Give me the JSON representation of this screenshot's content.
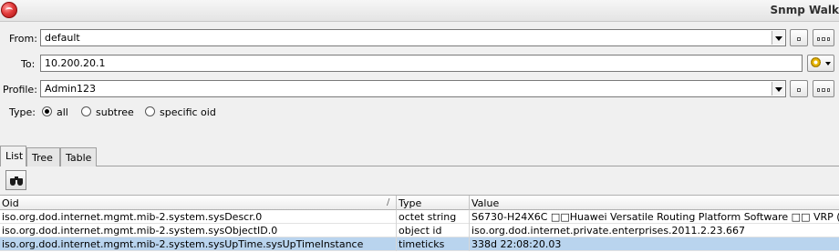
{
  "window": {
    "title": "Snmp Walk"
  },
  "form": {
    "from": {
      "label": "From:",
      "value": "default"
    },
    "to": {
      "label": "To:",
      "value": "10.200.20.1"
    },
    "profile": {
      "label": "Profile:",
      "value": "Admin123"
    },
    "type": {
      "label": "Type:",
      "options": [
        "all",
        "subtree",
        "specific oid"
      ],
      "selected": "all"
    }
  },
  "tabs": [
    "List",
    "Tree",
    "Table"
  ],
  "active_tab": "List",
  "toolbar": {
    "find_icon": "binoculars-icon"
  },
  "table": {
    "columns": [
      "Oid",
      "Type",
      "Value"
    ],
    "sort_indicator": "/",
    "rows": [
      {
        "oid": "iso.org.dod.internet.mgmt.mib-2.system.sysDescr.0",
        "type": "octet string",
        "value": "S6730-H24X6C □□Huawei Versatile Routing Platform Software □□ VRP (..."
      },
      {
        "oid": "iso.org.dod.internet.mgmt.mib-2.system.sysObjectID.0",
        "type": "object id",
        "value": "iso.org.dod.internet.private.enterprises.2011.2.23.667"
      },
      {
        "oid": "iso.org.dod.internet.mgmt.mib-2.system.sysUpTime.sysUpTimeInstance",
        "type": "timeticks",
        "value": "338d 22:08:20.03"
      }
    ],
    "selected_row": 2
  },
  "colors": {
    "selection": "#b9d4ee",
    "app_icon": "#e23b3b"
  }
}
